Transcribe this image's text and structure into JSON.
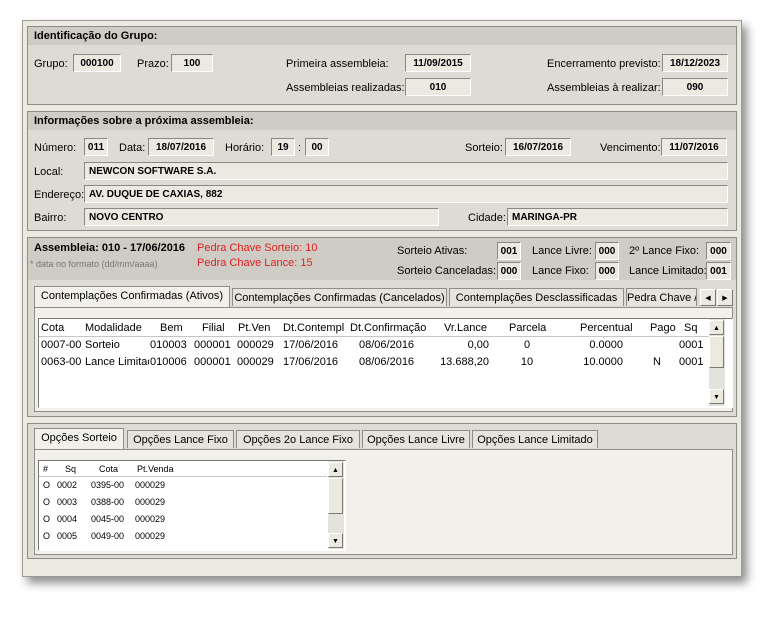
{
  "grupo": {
    "title": "Identificação do Grupo:",
    "grupo_label": "Grupo:",
    "grupo_value": "000100",
    "prazo_label": "Prazo:",
    "prazo_value": "100",
    "primeira_label": "Primeira assembleia:",
    "primeira_value": "11/09/2015",
    "realizadas_label": "Assembleias realizadas:",
    "realizadas_value": "010",
    "encerramento_label": "Encerramento previsto:",
    "encerramento_value": "18/12/2023",
    "arealizar_label": "Assembleias à realizar:",
    "arealizar_value": "090"
  },
  "proxima": {
    "title": "Informações sobre a próxima assembleia:",
    "numero_label": "Número:",
    "numero_value": "011",
    "data_label": "Data:",
    "data_value": "18/07/2016",
    "horario_label": "Horário:",
    "hora_value": "19",
    "sep": ":",
    "min_value": "00",
    "sorteio_label": "Sorteio:",
    "sorteio_value": "16/07/2016",
    "vencimento_label": "Vencimento:",
    "vencimento_value": "11/07/2016",
    "local_label": "Local:",
    "local_value": "NEWCON SOFTWARE S.A.",
    "endereco_label": "Endereço:",
    "endereco_value": "AV. DUQUE DE CAXIAS, 882",
    "bairro_label": "Bairro:",
    "bairro_value": "NOVO CENTRO",
    "cidade_label": "Cidade:",
    "cidade_value": "MARINGA-PR"
  },
  "assembleia": {
    "title": "Assembleia: 010 - 17/06/2016",
    "note": "* data no formato (dd/mm/aaaa)",
    "pedra_sorteio": "Pedra Chave Sorteio: 10",
    "pedra_lance": "Pedra Chave Lance: 15",
    "sorteio_ativas_label": "Sorteio Ativas:",
    "sorteio_ativas_value": "001",
    "sorteio_canceladas_label": "Sorteio Canceladas:",
    "sorteio_canceladas_value": "000",
    "lance_livre_label": "Lance Livre:",
    "lance_livre_value": "000",
    "lance_fixo_label": "Lance Fixo:",
    "lance_fixo_value": "000",
    "lance2_label": "2º Lance Fixo:",
    "lance2_value": "000",
    "lance_limitado_label": "Lance Limitado:",
    "lance_limitado_value": "001"
  },
  "contemplacoes": {
    "tabs": [
      "Contemplações Confirmadas (Ativos)",
      "Contemplações Confirmadas (Cancelados)",
      "Contemplações Desclassificadas",
      "Pedra Chave /"
    ],
    "columns": [
      "Cota",
      "Modalidade",
      "Bem",
      "Filial",
      "Pt.Ven",
      "Dt.Contempl",
      "Dt.Confirmação",
      "Vr.Lance",
      "Parcela",
      "Percentual",
      "Pago",
      "Sq"
    ],
    "rows": [
      [
        "0007-00",
        "Sorteio",
        "010003",
        "000001",
        "000029",
        "17/06/2016",
        "08/06/2016",
        "0,00",
        "0",
        "0.0000",
        "",
        "0001"
      ],
      [
        "0063-00",
        "Lance Limitado",
        "010006",
        "000001",
        "000029",
        "17/06/2016",
        "08/06/2016",
        "13.688,20",
        "10",
        "10.0000",
        "N",
        "0001"
      ]
    ]
  },
  "opcoes": {
    "tabs": [
      "Opções Sorteio",
      "Opções Lance Fixo",
      "Opções 2o Lance Fixo",
      "Opções Lance Livre",
      "Opções Lance Limitado"
    ],
    "columns": [
      "#",
      "Sq",
      "Cota",
      "Pt.Venda"
    ],
    "rows": [
      [
        "O",
        "0002",
        "0395-00",
        "000029"
      ],
      [
        "O",
        "0003",
        "0388-00",
        "000029"
      ],
      [
        "O",
        "0004",
        "0045-00",
        "000029"
      ],
      [
        "O",
        "0005",
        "0049-00",
        "000029"
      ]
    ]
  }
}
